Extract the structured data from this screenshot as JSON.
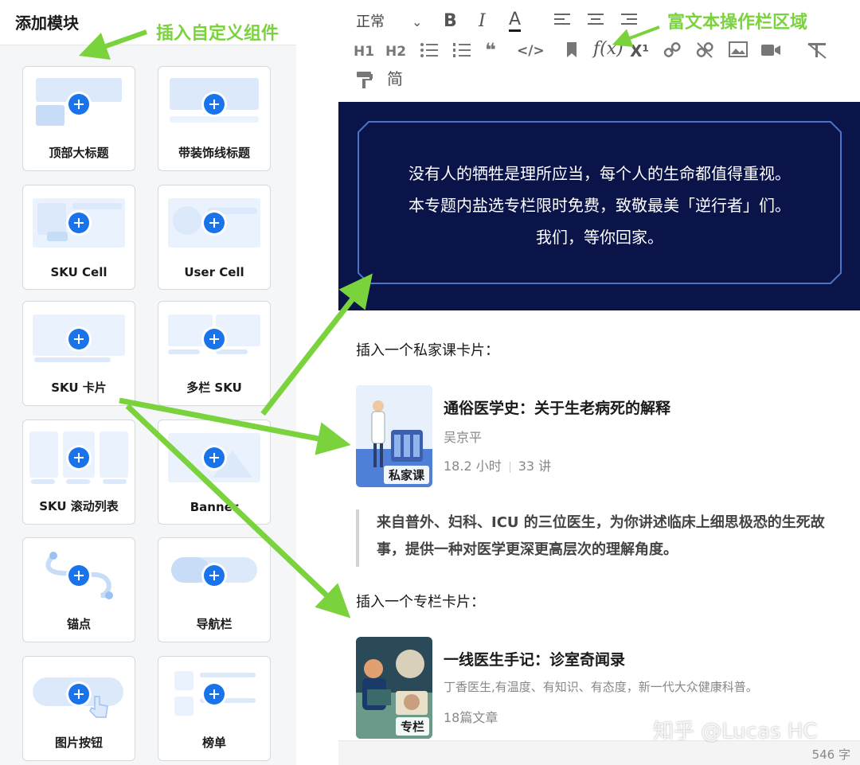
{
  "left_panel": {
    "title": "添加模块",
    "annotation": "插入自定义组件",
    "tiles": [
      {
        "label": "顶部大标题"
      },
      {
        "label": "带装饰线标题"
      },
      {
        "label": "SKU Cell"
      },
      {
        "label": "User Cell"
      },
      {
        "label": "SKU 卡片"
      },
      {
        "label": "多栏 SKU"
      },
      {
        "label": "SKU 滚动列表"
      },
      {
        "label": "Banner"
      },
      {
        "label": "锚点"
      },
      {
        "label": "导航栏"
      },
      {
        "label": "图片按钮"
      },
      {
        "label": "榜单"
      }
    ]
  },
  "toolbar": {
    "annotation": "富文本操作栏区域",
    "format_select": "正常",
    "bold": "B",
    "italic": "I",
    "underline_color": "A",
    "h1": "H1",
    "h2": "H2",
    "formula": "f(x)",
    "superscript": "X¹",
    "simplified": "简"
  },
  "banner": {
    "line1": "没有人的牺牲是理所应当，每个人的生命都值得重视。",
    "line2": "本专题内盐选专栏限时免费，致敬最美「逆行者」们。",
    "line3": "我们，等你回家。"
  },
  "content": {
    "private_course_label": "插入一个私家课卡片：",
    "course_card": {
      "title": "通俗医学史：关于生老病死的解释",
      "author": "吴京平",
      "hours": "18.2 小时",
      "lectures": "33 讲",
      "badge": "私家课"
    },
    "quote": "来自普外、妇科、ICU 的三位医生，为你讲述临床上细思极恐的生死故事，提供一种对医学更深更高层次的理解角度。",
    "column_label": "插入一个专栏卡片：",
    "column_card": {
      "title": "一线医生手记：诊室奇闻录",
      "description": "丁香医生,有温度、有知识、有态度，新一代大众健康科普。",
      "meta": "18篇文章",
      "badge": "专栏"
    }
  },
  "footer": {
    "word_count": "546 字"
  },
  "watermark": "知乎 @Lucas HC",
  "colors": {
    "accent_blue": "#1a73e8",
    "annotation_green": "#7ad33d",
    "banner_bg": "#0a1449"
  }
}
